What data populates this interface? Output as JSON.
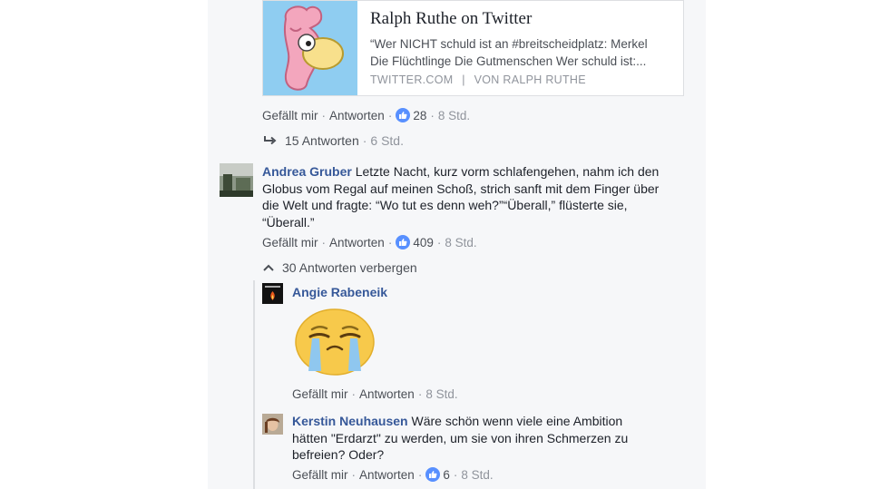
{
  "preview": {
    "title": "Ralph Ruthe on Twitter",
    "desc_line1": "“Wer NICHT schuld ist an #breitscheidplatz: Merkel",
    "desc_line2": "Die Flüchtlinge Die Gutmenschen Wer schuld ist:...",
    "source": "TWITTER.COM",
    "author": "VON RALPH RUTHE"
  },
  "comment1": {
    "like": "Gefällt mir",
    "reply": "Antworten",
    "likes": "28",
    "time": "8 Std.",
    "replies": "15 Antworten",
    "replies_time": "6 Std."
  },
  "comment2": {
    "author": "Andrea Gruber",
    "line1": "Letzte Nacht, kurz vorm schlafengehen, nahm ich den",
    "line2": "Globus vom Regal auf meinen Schoß, strich sanft mit dem Finger über",
    "line3": "die Welt und fragte: “Wo tut es denn weh?”“Überall,” flüsterte sie,",
    "line4": "“Überall.”",
    "like": "Gefällt mir",
    "reply": "Antworten",
    "likes": "409",
    "time": "8 Std.",
    "hide_replies": "30 Antworten verbergen"
  },
  "reply1": {
    "author": "Angie Rabeneik",
    "like": "Gefällt mir",
    "reply": "Antworten",
    "time": "8 Std."
  },
  "reply2": {
    "author": "Kerstin Neuhausen",
    "line1": "Wäre schön wenn viele eine Ambition",
    "line2": "hätten \"Erdarzt\" zu werden, um sie von ihren Schmerzen zu",
    "line3": "befreien? Oder?",
    "like": "Gefällt mir",
    "reply": "Antworten",
    "likes": "6",
    "time": "8 Std."
  },
  "colors": {
    "name": "#365899",
    "panel_bg": "#f6f7f9",
    "like_blue": "#5890ff"
  }
}
